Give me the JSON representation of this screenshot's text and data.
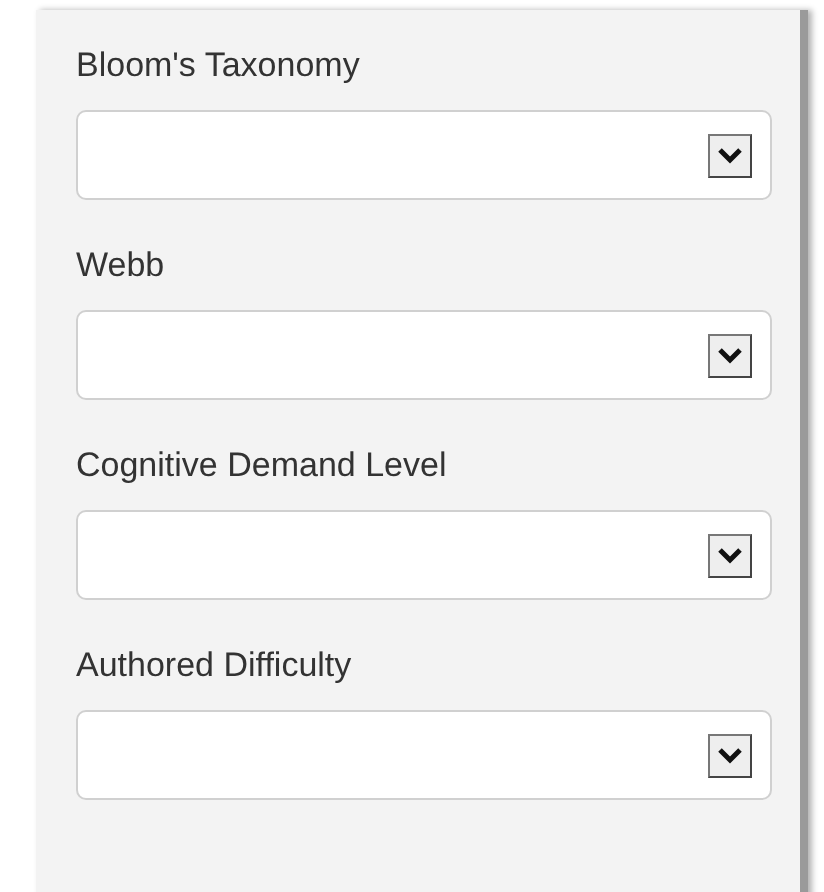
{
  "fields": [
    {
      "label": "Bloom's Taxonomy"
    },
    {
      "label": "Webb"
    },
    {
      "label": "Cognitive Demand Level"
    },
    {
      "label": "Authored Difficulty"
    }
  ]
}
